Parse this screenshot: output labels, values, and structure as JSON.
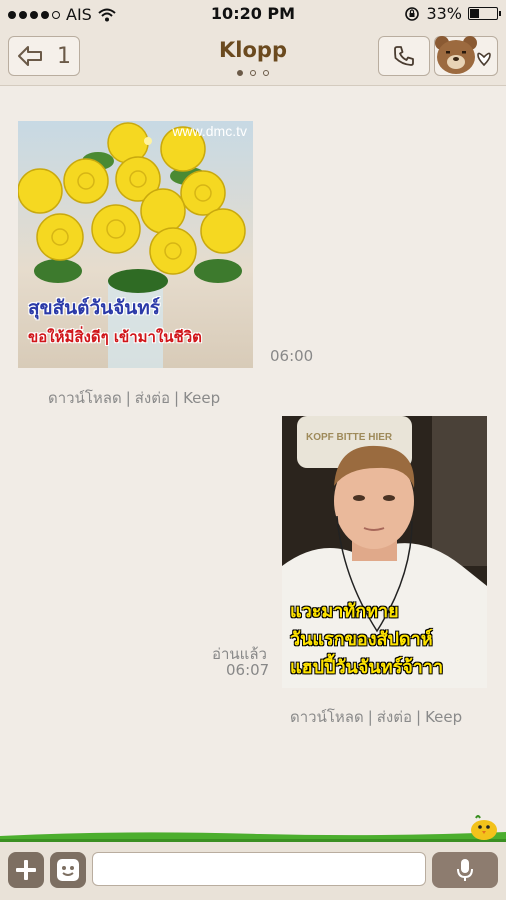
{
  "status_bar": {
    "carrier": "AIS",
    "time": "10:20 PM",
    "battery": "33%",
    "battery_level": 0.33
  },
  "header": {
    "back_count": "1",
    "title": "Klopp",
    "page_dots": 3,
    "active_dot": 0
  },
  "messages": [
    {
      "side": "left",
      "watermark": "www.dmc.tv",
      "caption_line1": "สุขสันต์วันจันทร์",
      "caption_line2": "ขอให้มีสิ่งดีๆ เข้ามาในชีวิต",
      "time": "06:00",
      "actions": [
        "ดาวน์โหลด",
        "ส่งต่อ",
        "Keep"
      ]
    },
    {
      "side": "right",
      "sign_text": "KOPF BITTE HIER",
      "caption_line1": "แวะมาทักทาย",
      "caption_line2": "วันแรกของสัปดาห์",
      "caption_line3": "แฮปปี้วันจันทร์จ้าาา",
      "read_label": "อ่านแล้ว",
      "time": "06:07",
      "actions": [
        "ดาวน์โหลด",
        "ส่งต่อ",
        "Keep"
      ]
    }
  ],
  "input": {
    "placeholder": ""
  },
  "colors": {
    "background": "#f1ece6",
    "title": "#6b4a1f",
    "toolbar": "#7d6f62"
  }
}
